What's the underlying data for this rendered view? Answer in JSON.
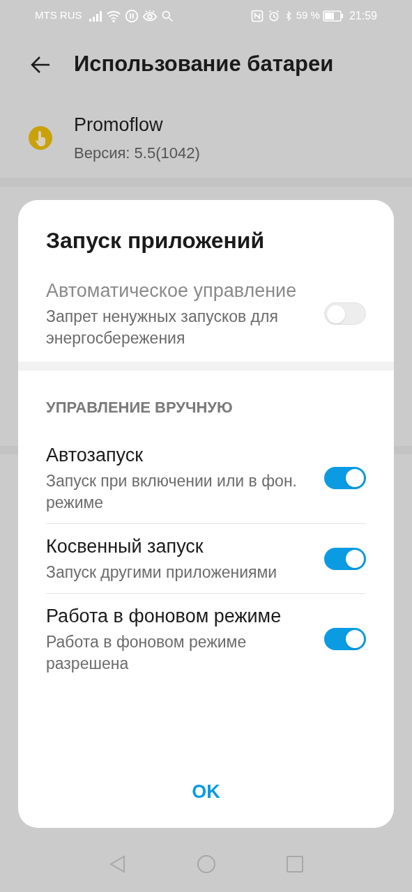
{
  "status_bar": {
    "carrier": "MTS RUS",
    "battery": "59 %",
    "time": "21:59"
  },
  "header": {
    "title": "Использование батареи"
  },
  "app": {
    "name": "Promoflow",
    "version": "Версия: 5.5(1042)"
  },
  "dialog": {
    "title": "Запуск приложений",
    "auto": {
      "title": "Автоматическое управление",
      "subtitle": "Запрет ненужных запусков для энергосбережения",
      "on": false,
      "disabled": true
    },
    "section": "УПРАВЛЕНИЕ ВРУЧНУЮ",
    "rows": [
      {
        "title": "Автозапуск",
        "subtitle": "Запуск при включении или в фон. режиме",
        "on": true
      },
      {
        "title": "Косвенный запуск",
        "subtitle": "Запуск другими приложениями",
        "on": true
      },
      {
        "title": "Работа в фоновом режиме",
        "subtitle": "Работа в фоновом режиме разрешена",
        "on": true
      }
    ],
    "button": "OK"
  }
}
